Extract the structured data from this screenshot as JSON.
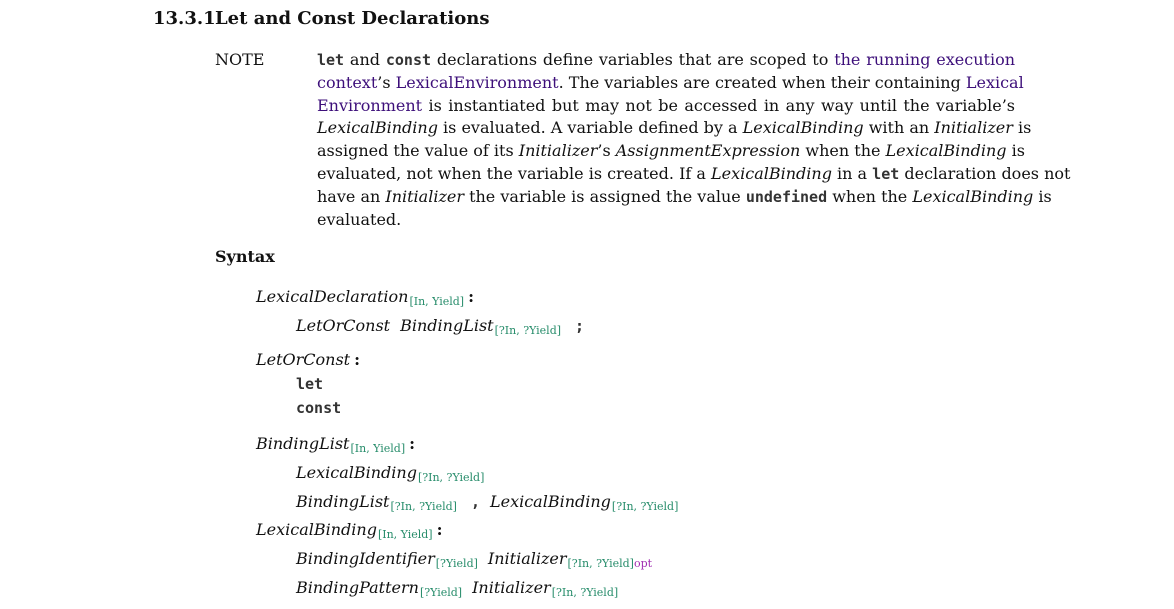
{
  "section": {
    "number": "13.3.1",
    "title": "Let and Const Declarations"
  },
  "note": {
    "label": "NOTE",
    "lines": [
      [
        {
          "t": "code",
          "v": "let"
        },
        {
          "t": "text",
          "v": " and "
        },
        {
          "t": "code",
          "v": "const"
        },
        {
          "t": "text",
          "v": " declarations define variables that are scoped to "
        },
        {
          "t": "link",
          "v": "the running execution"
        }
      ],
      [
        {
          "t": "link",
          "v": "context"
        },
        {
          "t": "text",
          "v": "’s "
        },
        {
          "t": "link",
          "v": "LexicalEnvironment"
        },
        {
          "t": "text",
          "v": ". The variables are created when their containing "
        },
        {
          "t": "link",
          "v": "Lexical"
        }
      ],
      [
        {
          "t": "link",
          "v": "Environment"
        },
        {
          "t": "text",
          "v": " is instantiated but may not be accessed in any way until the variable’s"
        }
      ],
      [
        {
          "t": "ital",
          "v": "LexicalBinding"
        },
        {
          "t": "text",
          "v": " is evaluated. A variable defined by a "
        },
        {
          "t": "ital",
          "v": "LexicalBinding"
        },
        {
          "t": "text",
          "v": " with an "
        },
        {
          "t": "ital",
          "v": "Initializer"
        },
        {
          "t": "text",
          "v": " is"
        }
      ],
      [
        {
          "t": "text",
          "v": "assigned the value of its "
        },
        {
          "t": "ital",
          "v": "Initializer"
        },
        {
          "t": "text",
          "v": "’s "
        },
        {
          "t": "ital",
          "v": "AssignmentExpression"
        },
        {
          "t": "text",
          "v": " when the "
        },
        {
          "t": "ital",
          "v": "LexicalBinding"
        },
        {
          "t": "text",
          "v": " is"
        }
      ],
      [
        {
          "t": "text",
          "v": "evaluated, not when the variable is created. If a "
        },
        {
          "t": "ital",
          "v": "LexicalBinding"
        },
        {
          "t": "text",
          "v": " in a "
        },
        {
          "t": "code",
          "v": "let"
        },
        {
          "t": "text",
          "v": " declaration does not"
        }
      ],
      [
        {
          "t": "text",
          "v": "have an "
        },
        {
          "t": "ital",
          "v": "Initializer"
        },
        {
          "t": "text",
          "v": " the variable is assigned the value "
        },
        {
          "t": "code",
          "v": "undefined"
        },
        {
          "t": "text",
          "v": " when the "
        },
        {
          "t": "ital",
          "v": "LexicalBinding"
        },
        {
          "t": "text",
          "v": " is"
        }
      ],
      [
        {
          "t": "text",
          "v": "evaluated."
        }
      ]
    ]
  },
  "syntax": {
    "heading": "Syntax",
    "productions": [
      {
        "lhs": {
          "name": "LexicalDeclaration",
          "params": "[In, Yield]"
        },
        "colon": ":",
        "rhs": [
          [
            {
              "t": "nt",
              "name": "LetOrConst",
              "params": ""
            },
            {
              "t": "nt",
              "name": "BindingList",
              "params": "[?In, ?Yield]"
            },
            {
              "t": "term",
              "v": ";"
            }
          ]
        ]
      },
      {
        "lhs": {
          "name": "LetOrConst",
          "params": ""
        },
        "colon": ":",
        "rhs": [
          [
            {
              "t": "term",
              "v": "let"
            }
          ],
          [
            {
              "t": "term",
              "v": "const"
            }
          ]
        ]
      },
      {
        "lhs": {
          "name": "BindingList",
          "params": "[In, Yield]"
        },
        "colon": ":",
        "rhs": [
          [
            {
              "t": "nt",
              "name": "LexicalBinding",
              "params": "[?In, ?Yield]"
            }
          ],
          [
            {
              "t": "nt",
              "name": "BindingList",
              "params": "[?In, ?Yield]"
            },
            {
              "t": "term",
              "v": ","
            },
            {
              "t": "nt",
              "name": "LexicalBinding",
              "params": "[?In, ?Yield]"
            }
          ]
        ]
      },
      {
        "lhs": {
          "name": "LexicalBinding",
          "params": "[In, Yield]"
        },
        "colon": ":",
        "rhs": [
          [
            {
              "t": "nt",
              "name": "BindingIdentifier",
              "params": "[?Yield]"
            },
            {
              "t": "nt",
              "name": "Initializer",
              "params": "[?In, ?Yield]",
              "opt": "opt"
            }
          ],
          [
            {
              "t": "nt",
              "name": "BindingPattern",
              "params": "[?Yield]"
            },
            {
              "t": "nt",
              "name": "Initializer",
              "params": "[?In, ?Yield]"
            }
          ]
        ]
      }
    ]
  }
}
